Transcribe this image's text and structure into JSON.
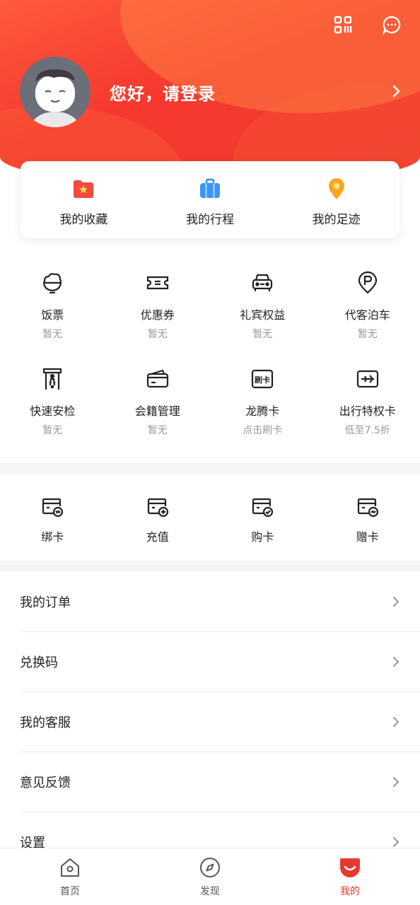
{
  "colors": {
    "brand_red": "#ee3b2f",
    "text": "#222222",
    "sub_text": "#999999",
    "separator": "#f4f5f7"
  },
  "header": {
    "greeting": "您好，请登录",
    "icons": [
      "scan-icon",
      "message-icon",
      "chevron-right-icon"
    ]
  },
  "quick": [
    {
      "label": "我的收藏",
      "icon": "folder-star-icon"
    },
    {
      "label": "我的行程",
      "icon": "briefcase-icon"
    },
    {
      "label": "我的足迹",
      "icon": "location-pin-icon"
    }
  ],
  "services": [
    {
      "title": "饭票",
      "sub": "暂无",
      "icon": "rice-bowl-icon"
    },
    {
      "title": "优惠券",
      "sub": "暂无",
      "icon": "coupon-icon"
    },
    {
      "title": "礼宾权益",
      "sub": "暂无",
      "icon": "car-icon"
    },
    {
      "title": "代客泊车",
      "sub": "暂无",
      "icon": "parking-icon"
    },
    {
      "title": "快速安检",
      "sub": "暂无",
      "icon": "security-gate-icon"
    },
    {
      "title": "会籍管理",
      "sub": "暂无",
      "icon": "wallet-card-icon"
    },
    {
      "title": "龙腾卡",
      "sub": "点击刷卡",
      "icon": "swipe-card-icon",
      "icon_text": "刷卡"
    },
    {
      "title": "出行特权卡",
      "sub": "低至7.5折",
      "icon": "plane-card-icon"
    }
  ],
  "card_actions": [
    {
      "label": "绑卡",
      "icon": "card-link-icon"
    },
    {
      "label": "充值",
      "icon": "card-add-icon"
    },
    {
      "label": "购卡",
      "icon": "card-check-icon"
    },
    {
      "label": "赠卡",
      "icon": "card-gift-icon"
    }
  ],
  "menu": [
    {
      "label": "我的订单"
    },
    {
      "label": "兑换码"
    },
    {
      "label": "我的客服"
    },
    {
      "label": "意见反馈"
    },
    {
      "label": "设置"
    }
  ],
  "nav": [
    {
      "label": "首页",
      "icon": "home-icon",
      "active": false
    },
    {
      "label": "发现",
      "icon": "compass-icon",
      "active": false
    },
    {
      "label": "我的",
      "icon": "profile-smile-icon",
      "active": true
    }
  ]
}
